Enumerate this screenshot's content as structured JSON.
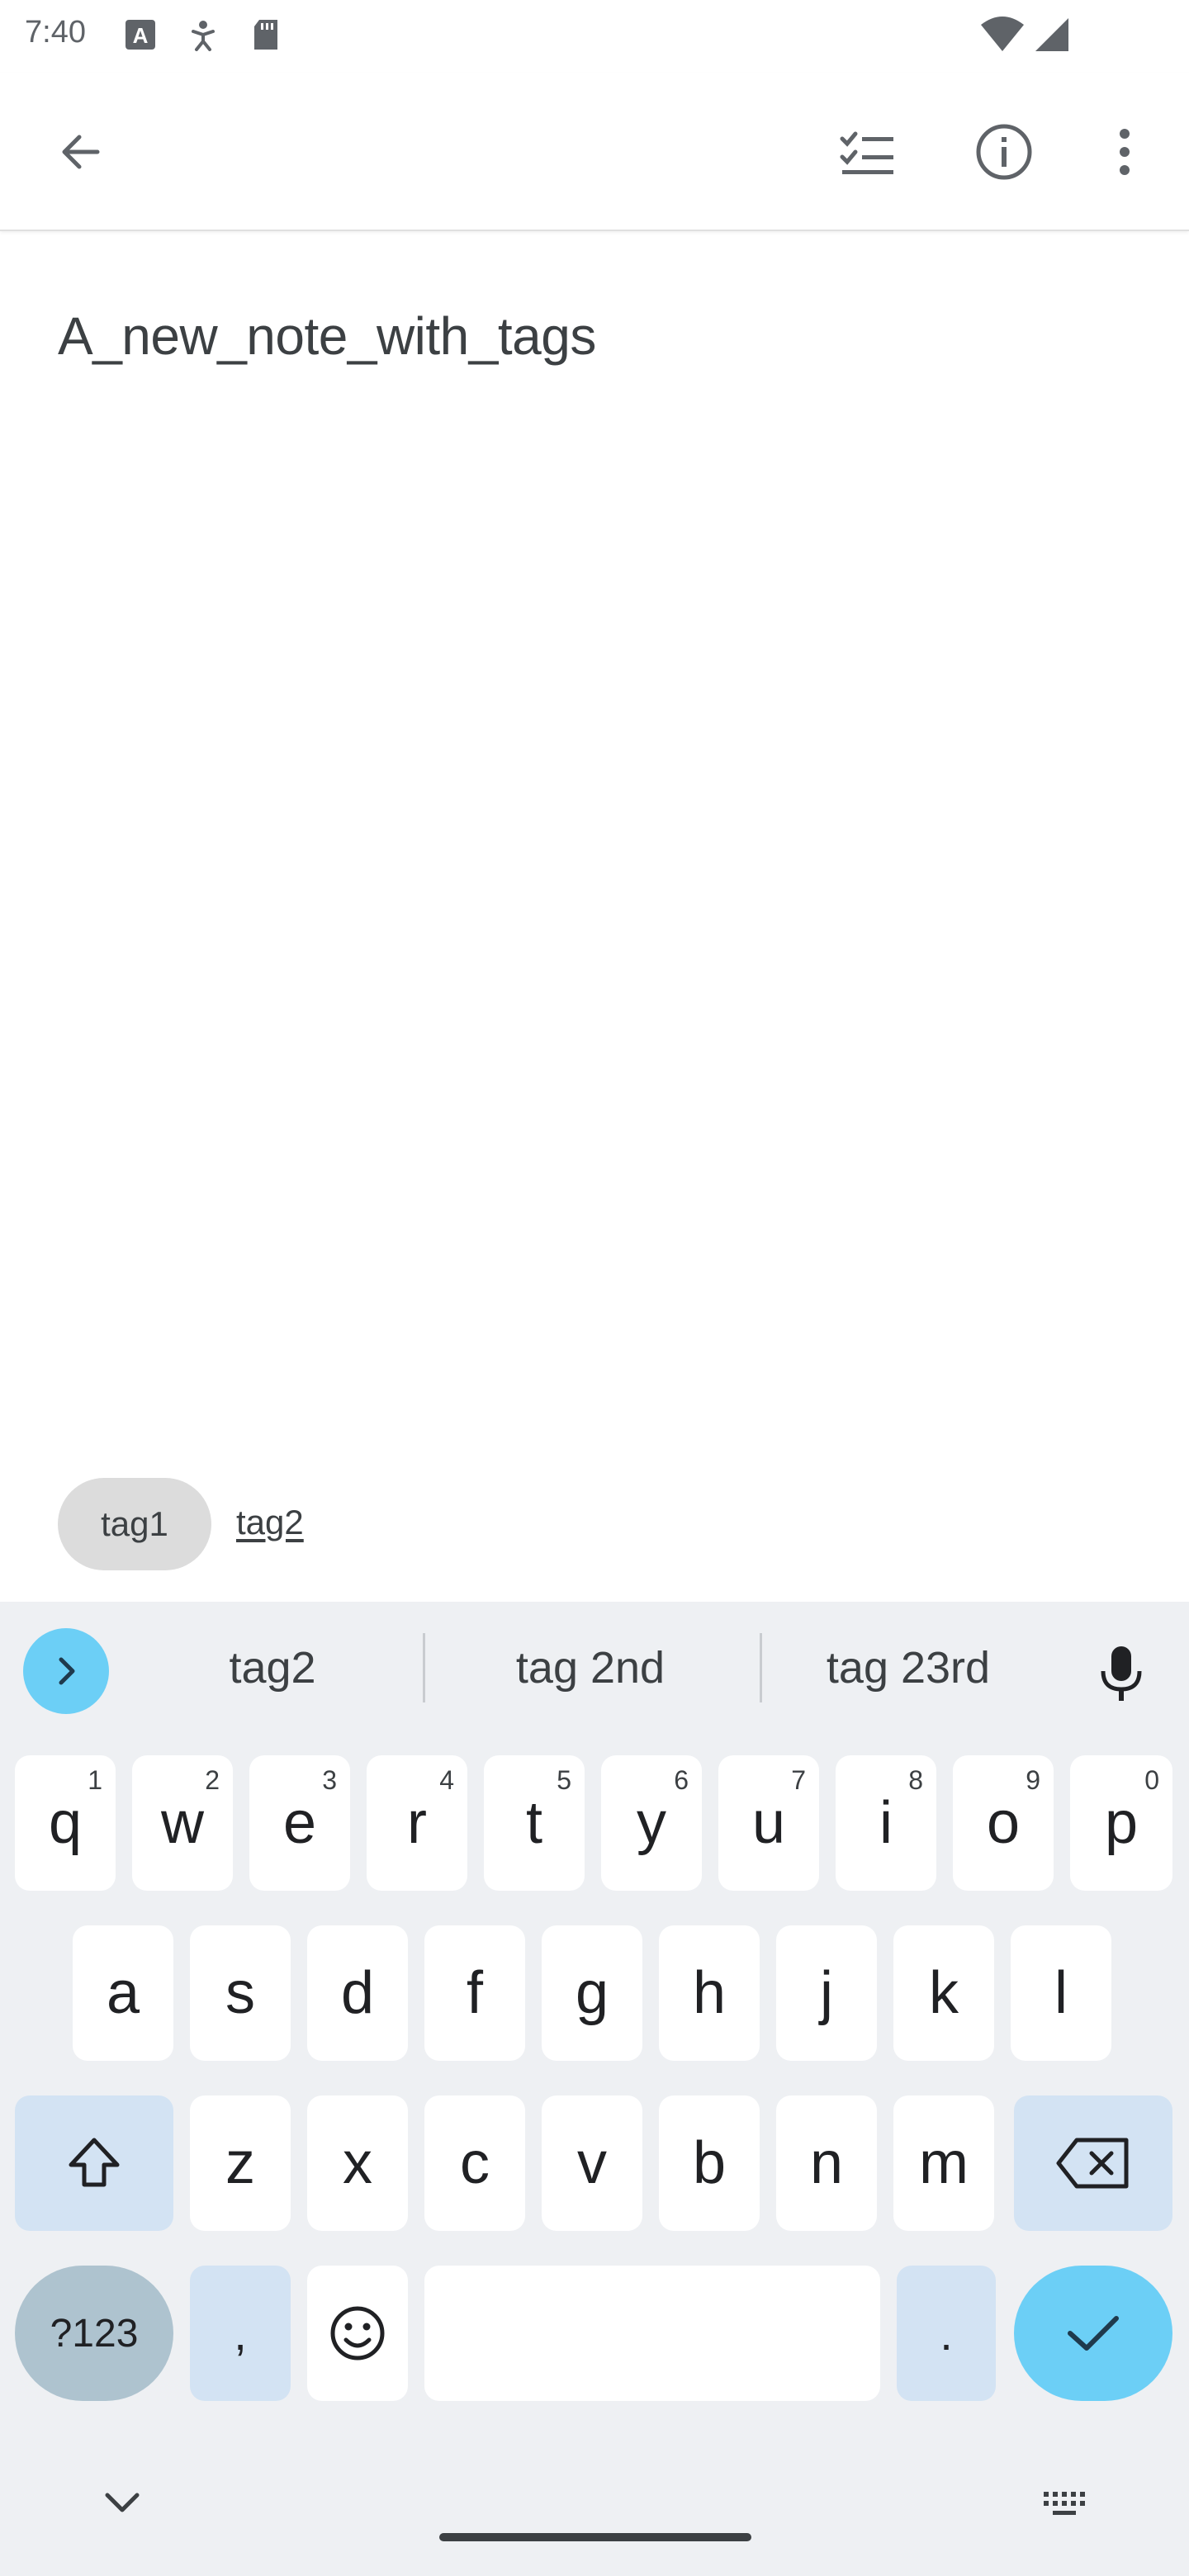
{
  "status_bar": {
    "time": "7:40"
  },
  "app_bar": {
    "back_icon": "arrow-back-icon",
    "checklist_icon": "checklist-icon",
    "info_icon": "info-icon",
    "more_icon": "more-vert-icon"
  },
  "note": {
    "title": "A_new_note_with_tags"
  },
  "tags": {
    "chips": [
      "tag1"
    ],
    "input_value": "tag2"
  },
  "keyboard": {
    "suggestions": [
      "tag2",
      "tag 2nd",
      "tag 23rd"
    ],
    "row1": [
      {
        "key": "q",
        "hint": "1"
      },
      {
        "key": "w",
        "hint": "2"
      },
      {
        "key": "e",
        "hint": "3"
      },
      {
        "key": "r",
        "hint": "4"
      },
      {
        "key": "t",
        "hint": "5"
      },
      {
        "key": "y",
        "hint": "6"
      },
      {
        "key": "u",
        "hint": "7"
      },
      {
        "key": "i",
        "hint": "8"
      },
      {
        "key": "o",
        "hint": "9"
      },
      {
        "key": "p",
        "hint": "0"
      }
    ],
    "row2": [
      "a",
      "s",
      "d",
      "f",
      "g",
      "h",
      "j",
      "k",
      "l"
    ],
    "row3": [
      "z",
      "x",
      "c",
      "v",
      "b",
      "n",
      "m"
    ],
    "symbols_label": "?123",
    "comma_label": ",",
    "period_label": ".",
    "colors": {
      "background": "#eef0f3",
      "accent": "#6ccff6",
      "special_key": "#d3e3f3",
      "symbols_key": "#aec3cf"
    }
  }
}
